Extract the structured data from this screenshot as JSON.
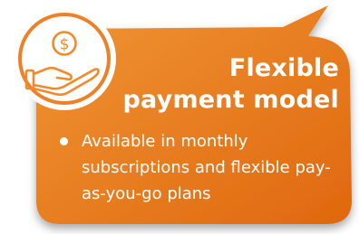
{
  "card": {
    "title_line1": "Flexible",
    "title_line2": "payment model",
    "bullet_text": "Available in monthly subscriptions and flexible pay-as-you-go plans",
    "icon": "hand-holding-dollar-icon"
  },
  "colors": {
    "card_gradient_start": "#ef8e2e",
    "card_gradient_end": "#e06a10",
    "icon_stroke": "#f08a2a",
    "icon_ring": "#ffffff",
    "text": "#ffffff"
  }
}
